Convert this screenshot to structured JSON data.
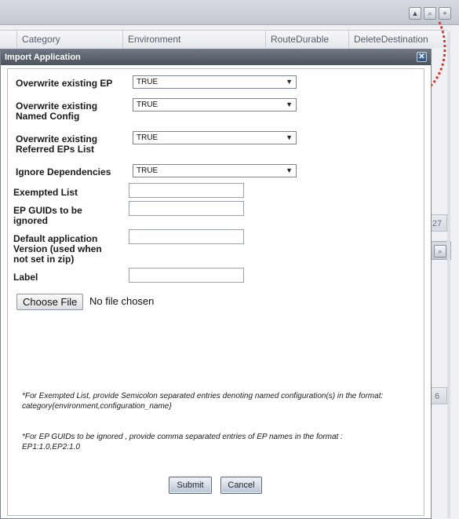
{
  "background": {
    "columns": [
      "Category",
      "Environment",
      "RouteDurable",
      "DeleteDestination"
    ],
    "fragment_top": "27",
    "fragment_bottom": "6",
    "tool_icons": [
      "up-arrow-icon",
      "zoom-icon",
      "maximize-icon"
    ]
  },
  "dialog": {
    "title": "Import Application",
    "close_icon": "close-icon",
    "fields": {
      "overwrite_ep_label": "Overwrite existing EP",
      "overwrite_ep_value": "TRUE",
      "overwrite_named_config_label_1": "Overwrite existing",
      "overwrite_named_config_label_2": "Named Config",
      "overwrite_named_config_value": "TRUE",
      "overwrite_referred_label_1": "Overwrite existing",
      "overwrite_referred_label_2": "Referred EPs List",
      "overwrite_referred_value": "TRUE",
      "ignore_dependencies_label": "Ignore Dependencies",
      "ignore_dependencies_value": "TRUE",
      "exempted_list_label": "Exempted List",
      "exempted_list_value": "",
      "ep_guids_label_1": "EP GUIDs to be",
      "ep_guids_label_2": "ignored",
      "ep_guids_value": "",
      "default_version_label_1": "Default application",
      "default_version_label_2": "Version (used when",
      "default_version_label_3": "not set in zip)",
      "default_version_value": "",
      "label_label": "Label",
      "label_value": ""
    },
    "file": {
      "button_label": "Choose File",
      "status": "No file chosen"
    },
    "notes": {
      "exempted_1": "*For Exempted List, provide Semicolon separated entries denoting named configuration(s) in the format:",
      "exempted_2": "category{environment,configuration_name}",
      "guids_1": "*For EP GUIDs to be ignored , provide comma separated entries of EP names in the format :",
      "guids_2": "EP1:1.0,EP2:1.0"
    },
    "buttons": {
      "submit": "Submit",
      "cancel": "Cancel"
    }
  },
  "colors": {
    "title_bar": "#4c535c",
    "annotation": "#e0322a",
    "button_gradient_bottom": "#b7c3d1"
  }
}
